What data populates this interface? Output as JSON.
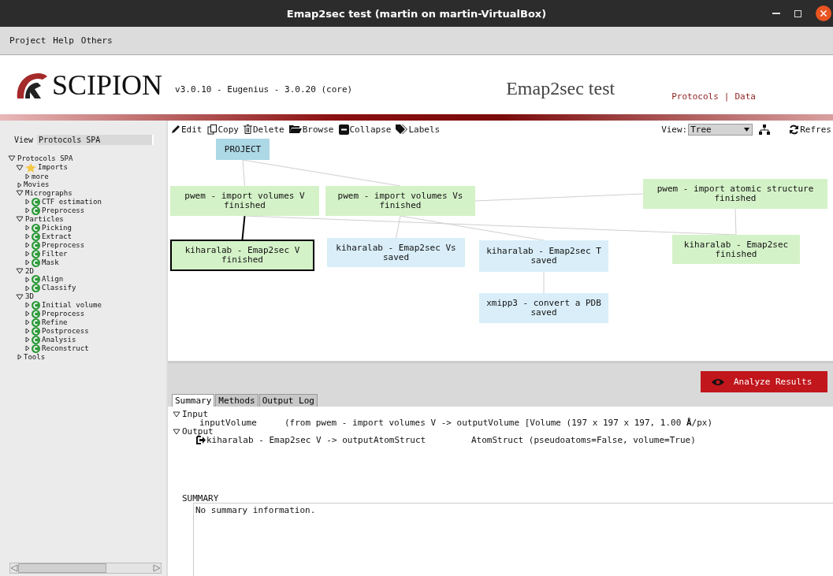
{
  "window": {
    "title": "Emap2sec test (martin on martin-VirtualBox)"
  },
  "menu": [
    "Project",
    "Help",
    "Others"
  ],
  "header": {
    "logo_text": "SCIPION",
    "version": "v3.0.10 - Eugenius - 3.0.20 (core)",
    "project": "Emap2sec test",
    "links": [
      "Protocols",
      "|",
      "Data"
    ]
  },
  "sidebar": {
    "view_label": "View",
    "view_value": "Protocols SPA",
    "tree": [
      {
        "label": "Protocols SPA",
        "expanded": true,
        "children": [
          {
            "label": "Imports",
            "kind": "star",
            "expanded": true,
            "children": [
              {
                "label": "more",
                "expanded": false
              }
            ]
          },
          {
            "label": "Movies",
            "expanded": false
          },
          {
            "label": "Micrographs",
            "expanded": true,
            "children": [
              {
                "label": "CTF estimation",
                "kind": "category",
                "expanded": false
              },
              {
                "label": "Preprocess",
                "kind": "category",
                "expanded": false
              }
            ]
          },
          {
            "label": "Particles",
            "expanded": true,
            "children": [
              {
                "label": "Picking",
                "kind": "category",
                "expanded": false
              },
              {
                "label": "Extract",
                "kind": "category",
                "expanded": false
              },
              {
                "label": "Preprocess",
                "kind": "category",
                "expanded": false
              },
              {
                "label": "Filter",
                "kind": "category",
                "expanded": false
              },
              {
                "label": "Mask",
                "kind": "category",
                "expanded": false
              }
            ]
          },
          {
            "label": "2D",
            "expanded": true,
            "children": [
              {
                "label": "Align",
                "kind": "category",
                "expanded": false
              },
              {
                "label": "Classify",
                "kind": "category",
                "expanded": false
              }
            ]
          },
          {
            "label": "3D",
            "expanded": true,
            "children": [
              {
                "label": "Initial volume",
                "kind": "category",
                "expanded": false
              },
              {
                "label": "Preprocess",
                "kind": "category",
                "expanded": false
              },
              {
                "label": "Refine",
                "kind": "category",
                "expanded": false
              },
              {
                "label": "Postprocess",
                "kind": "category",
                "expanded": false
              },
              {
                "label": "Analysis",
                "kind": "category",
                "expanded": false
              },
              {
                "label": "Reconstruct",
                "kind": "category",
                "expanded": false
              }
            ]
          },
          {
            "label": "Tools",
            "expanded": false
          }
        ]
      }
    ]
  },
  "toolbar": [
    {
      "label": "Edit",
      "kind": "edit"
    },
    {
      "label": "Copy",
      "kind": "copy"
    },
    {
      "label": "Delete",
      "kind": "delete"
    },
    {
      "label": "Browse",
      "kind": "browse"
    },
    {
      "label": "Collapse",
      "kind": "collapse"
    },
    {
      "label": "Labels",
      "kind": "labels"
    }
  ],
  "view": {
    "label": "View:",
    "value": "Tree"
  },
  "refresh": "Refres",
  "graph": {
    "nodes": [
      {
        "label": "PROJECT",
        "kind": "project",
        "selected": false
      },
      {
        "label": "pwem - import volumes V",
        "status": "finished",
        "kind": "protocol",
        "color": "#d4f2c8",
        "selected": false
      },
      {
        "label": "pwem - import volumes Vs",
        "status": "finished",
        "kind": "protocol",
        "color": "#d4f2c8",
        "selected": false
      },
      {
        "label": "pwem - import atomic structure",
        "status": "finished",
        "kind": "protocol",
        "color": "#d4f2c8",
        "selected": false
      },
      {
        "label": "kiharalab - Emap2sec V",
        "status": "finished",
        "kind": "protocol",
        "color": "#d4f2c8",
        "selected": true
      },
      {
        "label": "kiharalab - Emap2sec Vs",
        "status": "saved",
        "kind": "protocol",
        "color": "#d9eef8",
        "selected": false
      },
      {
        "label": "kiharalab - Emap2sec T",
        "status": "saved",
        "kind": "protocol",
        "color": "#d9eef8",
        "selected": false
      },
      {
        "label": "kiharalab - Emap2sec",
        "status": "finished",
        "kind": "protocol",
        "color": "#d4f2c8",
        "selected": false
      },
      {
        "label": "xmipp3 - convert a PDB",
        "status": "saved",
        "kind": "protocol",
        "color": "#d9eef8",
        "selected": false
      }
    ]
  },
  "analyze_button": "Analyze Results",
  "tabs": [
    {
      "label": "Summary",
      "selected": true
    },
    {
      "label": "Methods",
      "selected": false
    },
    {
      "label": "Output Log",
      "selected": false
    }
  ],
  "io": [
    {
      "label": "Input",
      "expanded": true,
      "rows": [
        {
          "kind": "input",
          "name": "inputVolume",
          "detail": "(from pwem - import volumes V -> outputVolume [Volume (197 x 197 x 197, 1.00 **Å**/px)"
        }
      ]
    },
    {
      "label": "Output",
      "expanded": true,
      "rows": [
        {
          "kind": "output",
          "name": "kiharalab - Emap2sec V -> outputAtomStruct",
          "detail": "AtomStruct (pseudoatoms=False, volume=True)"
        }
      ]
    }
  ],
  "summary": {
    "heading": "SUMMARY",
    "text": "No summary information."
  }
}
